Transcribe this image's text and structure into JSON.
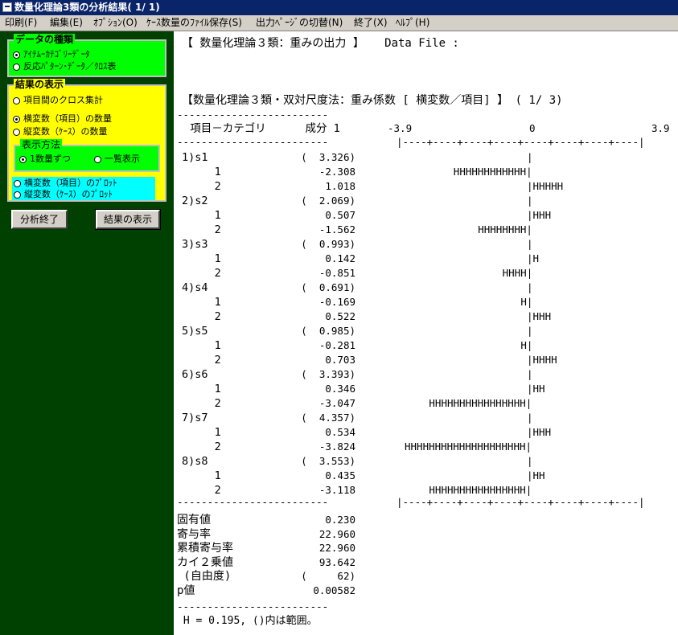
{
  "window": {
    "title": "数量化理論3類の分析結果( 1/ 1)"
  },
  "menu": [
    {
      "label": "印刷(F)"
    },
    {
      "label": "編集(E)"
    },
    {
      "label": "ｵﾌﾟｼｮﾝ(O)"
    },
    {
      "label": "ｹｰｽ数量のﾌｧｲﾙ保存(S)"
    },
    {
      "label": "出力ﾍﾟｰｼﾞの切替(N)"
    },
    {
      "label": "終了(X)"
    },
    {
      "label": "ﾍﾙﾌﾟ(H)"
    }
  ],
  "sidebar": {
    "data_type": {
      "legend": "データの種類",
      "options": [
        {
          "label": "ｱｲﾃﾑｰｶﾃｺﾞﾘｰﾃﾞｰﾀ",
          "selected": true
        },
        {
          "label": "反応ﾊﾟﾀｰﾝ･ﾃﾞｰﾀ／ｸﾛｽ表",
          "selected": false
        }
      ]
    },
    "result": {
      "legend": "結果の表示",
      "cross_option": {
        "label": "項目間のクロス集計",
        "selected": false
      },
      "options": [
        {
          "label": "横変数（項目）の数量",
          "selected": true
        },
        {
          "label": "縦変数（ｹｰｽ）の数量",
          "selected": false
        }
      ],
      "method": {
        "legend": "表示方法",
        "options": [
          {
            "label": "1数量ずつ",
            "selected": true
          },
          {
            "label": "一覧表示",
            "selected": false
          }
        ]
      },
      "plot_options": [
        {
          "label": "横変数（項目）のﾌﾟﾛｯﾄ",
          "selected": false
        },
        {
          "label": "縦変数（ｹｰｽ）のﾌﾟﾛｯﾄ",
          "selected": false
        }
      ]
    },
    "buttons": {
      "finish": "分析終了",
      "show": "結果の表示"
    }
  },
  "output": {
    "header": "【 数量化理論３類：重みの出力 】   Data File :",
    "section_title": "【数量化理論３類・双対尺度法：重み係数 [ 横変数／項目] 】 ( 1/ 3)",
    "dash_line": "-------------------------",
    "col_header": "  項目－カテゴリ      成分 1",
    "scale_labels": {
      "min": "-3.9",
      "zero": "0",
      "max": "3.9"
    },
    "scale_axis": "|----+----+----+----+----+----+----+----|",
    "rows": [
      {
        "left": "1)s1",
        "value": "(  3.326)",
        "bar": "",
        "type": "item"
      },
      {
        "left": "     1",
        "value": "-2.308",
        "bar": "HHHHHHHHHHHH|",
        "type": "cat"
      },
      {
        "left": "     2",
        "value": "1.018",
        "bar": "|HHHHH",
        "type": "cat"
      },
      {
        "left": "2)s2",
        "value": "(  2.069)",
        "bar": "",
        "type": "item"
      },
      {
        "left": "     1",
        "value": "0.507",
        "bar": "|HHH",
        "type": "cat"
      },
      {
        "left": "     2",
        "value": "-1.562",
        "bar": "HHHHHHHH|",
        "type": "cat"
      },
      {
        "left": "3)s3",
        "value": "(  0.993)",
        "bar": "",
        "type": "item"
      },
      {
        "left": "     1",
        "value": "0.142",
        "bar": "|H",
        "type": "cat"
      },
      {
        "left": "     2",
        "value": "-0.851",
        "bar": "HHHH|",
        "type": "cat"
      },
      {
        "left": "4)s4",
        "value": "(  0.691)",
        "bar": "",
        "type": "item"
      },
      {
        "left": "     1",
        "value": "-0.169",
        "bar": "H|",
        "type": "cat"
      },
      {
        "left": "     2",
        "value": "0.522",
        "bar": "|HHH",
        "type": "cat"
      },
      {
        "left": "5)s5",
        "value": "(  0.985)",
        "bar": "",
        "type": "item"
      },
      {
        "left": "     1",
        "value": "-0.281",
        "bar": "H|",
        "type": "cat"
      },
      {
        "left": "     2",
        "value": "0.703",
        "bar": "|HHHH",
        "type": "cat"
      },
      {
        "left": "6)s6",
        "value": "(  3.393)",
        "bar": "",
        "type": "item"
      },
      {
        "left": "     1",
        "value": "0.346",
        "bar": "|HH",
        "type": "cat"
      },
      {
        "left": "     2",
        "value": "-3.047",
        "bar": "HHHHHHHHHHHHHHHH|",
        "type": "cat"
      },
      {
        "left": "7)s7",
        "value": "(  4.357)",
        "bar": "",
        "type": "item"
      },
      {
        "left": "     1",
        "value": "0.534",
        "bar": "|HHH",
        "type": "cat"
      },
      {
        "left": "     2",
        "value": "-3.824",
        "bar": "HHHHHHHHHHHHHHHHHHHH|",
        "type": "cat"
      },
      {
        "left": "8)s8",
        "value": "(  3.553)",
        "bar": "",
        "type": "item"
      },
      {
        "left": "     1",
        "value": "0.435",
        "bar": "|HH",
        "type": "cat"
      },
      {
        "left": "     2",
        "value": "-3.118",
        "bar": "HHHHHHHHHHHHHHHH|",
        "type": "cat"
      }
    ],
    "stats": [
      {
        "label": "固有値",
        "value": "0.230"
      },
      {
        "label": "寄与率",
        "value": "22.960"
      },
      {
        "label": "累積寄与率",
        "value": "22.960"
      },
      {
        "label": "カイ２乗値",
        "value": "93.642"
      },
      {
        "label": " (自由度)",
        "value": "(     62)"
      },
      {
        "label": "p値",
        "value": "0.00582"
      }
    ],
    "footer": " H = 0.195, ()内は範囲。"
  }
}
